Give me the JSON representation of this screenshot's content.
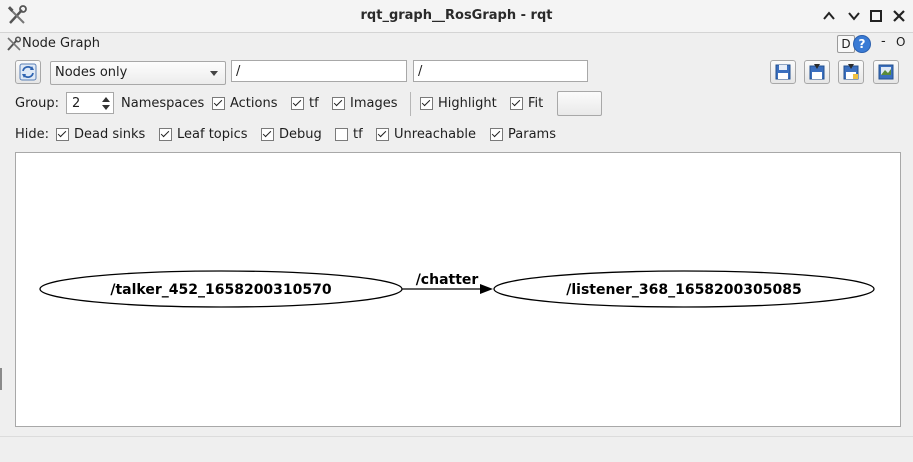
{
  "window": {
    "title": "rqt_graph__RosGraph - rqt"
  },
  "plugin": {
    "title": "Node Graph",
    "d_label": "D",
    "help_label": "?",
    "dash_label": "-",
    "o_label": "O"
  },
  "toolbar": {
    "refresh_icon": "refresh-icon",
    "filter_mode": "Nodes only",
    "ns_filter": "/",
    "topic_filter": "/",
    "buttons": [
      "load-dot-icon",
      "save-dot-icon",
      "save-svg-icon",
      "save-image-icon"
    ]
  },
  "options": {
    "group_label": "Group:",
    "group_value": "2",
    "namespaces_label": "Namespaces",
    "namespaces_checked": true,
    "actions_label": "Actions",
    "actions_checked": true,
    "tf_label": "tf",
    "tf_checked": true,
    "images_label": "Images",
    "images_checked": true,
    "highlight_label": "Highlight",
    "highlight_checked": true,
    "fit_label": "Fit",
    "fit_checked": true
  },
  "hide": {
    "label": "Hide:",
    "dead_sinks_label": "Dead sinks",
    "dead_sinks_checked": true,
    "leaf_topics_label": "Leaf topics",
    "leaf_topics_checked": true,
    "debug_label": "Debug",
    "debug_checked": true,
    "tf_label": "tf",
    "tf_checked": false,
    "unreachable_label": "Unreachable",
    "unreachable_checked": true,
    "params_label": "Params",
    "params_checked": true
  },
  "graph": {
    "source_node": "/talker_452_1658200310570",
    "target_node": "/listener_368_1658200305085",
    "edge_label": "/chatter"
  }
}
